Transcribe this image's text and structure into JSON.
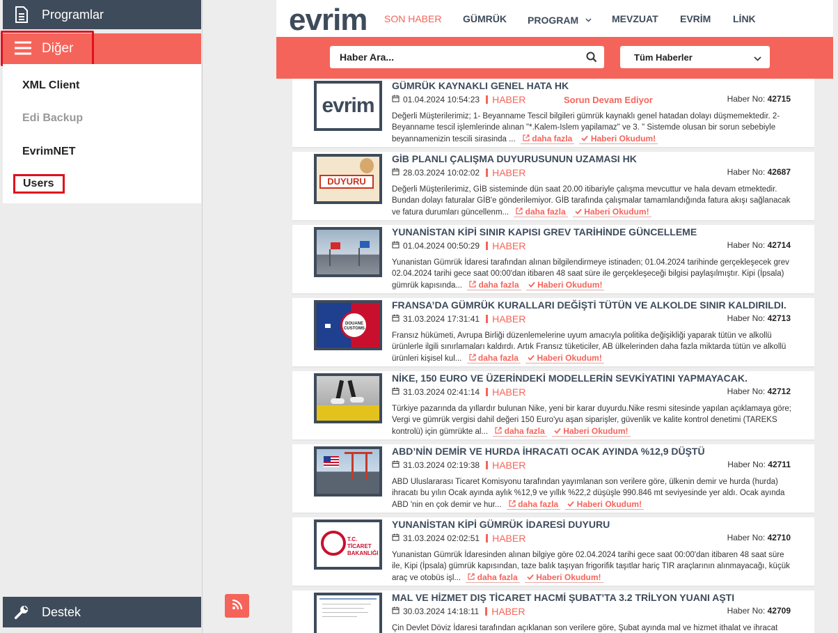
{
  "sidebar": {
    "programlar": "Programlar",
    "diger": "Diğer",
    "items": [
      "XML Client",
      "Edi Backup",
      "EvrimNET"
    ],
    "users": "Users",
    "destek": "Destek"
  },
  "nav": {
    "logo": "evrim",
    "links": [
      "SON HABER",
      "GÜMRÜK",
      "PROGRAM",
      "MEVZUAT",
      "EVRİM",
      "LİNK"
    ]
  },
  "search": {
    "placeholder": "Haber Ara...",
    "filter": "Tüm Haberler"
  },
  "labels": {
    "more": "daha fazla",
    "read": "Haberi Okudum!",
    "no_prefix": "Haber No:"
  },
  "colors": {
    "accent": "#f5645a",
    "dark": "#3e4b5b"
  },
  "news": [
    {
      "title": "GÜMRÜK KAYNAKLI GENEL HATA HK",
      "date": "01.04.2024 10:54:23",
      "kind": "HABER",
      "status": "Sorun Devam Ediyor",
      "no": "42715",
      "summary": "Değerli Müşterilerimiz; 1- Beyanname Tescil bilgileri gümrük kaynaklı genel hatadan dolayı düşmemektedir. 2- Beyanname tescil işlemlerinde alınan \"*.Kalem-Islem yapilamaz\" ve 3. \" Sistemde olusan bir sorun sebebiyle beyannamenizin tescili sirasinda ..."
    },
    {
      "title": "GİB PLANLI ÇALIŞMA DUYURUSUNUN UZAMASI HK",
      "date": "28.03.2024 10:02:02",
      "kind": "HABER",
      "no": "42687",
      "summary": "Değerli Müşterilerimiz, GİB sisteminde dün saat 20.00 itibariyle çalışma mevcuttur ve hala devam etmektedir. Bundan dolayı faturalar GİB'e gönderilemiyor. GİB tarafında çalışmalar tamamlandığında fatura akışı sağlanacak ve fatura durumları güncellenm..."
    },
    {
      "title": "YUNANİSTAN KİPİ SINIR KAPISI GREV TARİHİNDE GÜNCELLEME",
      "date": "01.04.2024 00:50:29",
      "kind": "HABER",
      "no": "42714",
      "summary": "Yunanistan Gümrük İdaresi tarafından alınan bilgilendirmeye istinaden; 01.04.2024 tarihinde gerçekleşecek grev 02.04.2024 tarihi gece saat 00:00'dan itibaren 48 saat süre ile gerçekleşeceği bilgisi paylaşılmıştır. Kipi (İpsala) gümrük kapısında..."
    },
    {
      "title": "FRANSA’DA GÜMRÜK KURALLARI DEĞİŞTİ TÜTÜN VE ALKOLDE SINIR KALDIRILDI.",
      "date": "31.03.2024 17:31:41",
      "kind": "HABER",
      "no": "42713",
      "summary": "Fransız hükümeti, Avrupa Birliği düzenlemelerine uyum amacıyla politika değişikliği yaparak tütün ve alkollü ürünlerle ilgili sınırlamaları kaldırdı. Artık Fransız tüketiciler, AB ülkelerinden daha fazla miktarda tütün ve alkollü ürünleri kişisel kul..."
    },
    {
      "title": "NİKE, 150 EURO VE ÜZERİNDEKİ MODELLERİN SEVKİYATINI YAPMAYACAK.",
      "date": "31.03.2024 02:41:14",
      "kind": "HABER",
      "no": "42712",
      "summary": "Türkiye pazarında da yıllardır bulunan Nike, yeni bir karar duyurdu.Nike resmi sitesinde yapılan açıklamaya göre; Vergi ve gümrük vergisi dahil değeri 150 Euro'yu aşan siparişler, güvenlik ve kalite kontrol denetimi (TAREKS kontrolü) için gümrükte al..."
    },
    {
      "title": "ABD’NİN DEMİR VE HURDA İHRACATI OCAK AYINDA %12,9 DÜŞTÜ",
      "date": "31.03.2024 02:19:38",
      "kind": "HABER",
      "no": "42711",
      "summary": "ABD Uluslararası Ticaret Komisyonu tarafından yayımlanan son verilere göre, ülkenin demir ve hurda (hurda) ihracatı bu yılın Ocak ayında aylık %12,9 ve yıllık %22,2 düşüşle 990.846 mt seviyesinde yer aldı. Ocak ayında ABD 'nin en çok demir ve hur..."
    },
    {
      "title": "YUNANİSTAN KİPİ GÜMRÜK İDARESİ DUYURU",
      "date": "31.03.2024 02:02:51",
      "kind": "HABER",
      "no": "42710",
      "summary": "Yunanistan Gümrük İdaresinden alınan bilgiye göre 02.04.2024 tarihi gece saat 00:00'dan itibaren 48 saat süre ile, Kipi (İpsala) gümrük kapısından, taze balık taşıyan frigorifik taşıtlar hariç TIR araçlarının alınmayacağı, küçük araç ve otobüs işl..."
    },
    {
      "title": "MAL VE HİZMET DIŞ TİCARET HACMİ ŞUBAT’TA 3.2 TRİLYON YUANI AŞTI",
      "date": "30.03.2024 14:18:11",
      "kind": "HABER",
      "no": "42709",
      "summary": "Çin Devlet Döviz İdaresi tarafından açıklanan son verilere göre, Şubat ayında mal ve hizmet ithalat ve ihracat"
    }
  ],
  "thumbs": {
    "evrim_logo": "evrim",
    "duyuru": "DUYURU",
    "customs": "DOUANE CUSTOMS",
    "ticaret": "T.C. TİCARET BAKANLIĞI"
  }
}
